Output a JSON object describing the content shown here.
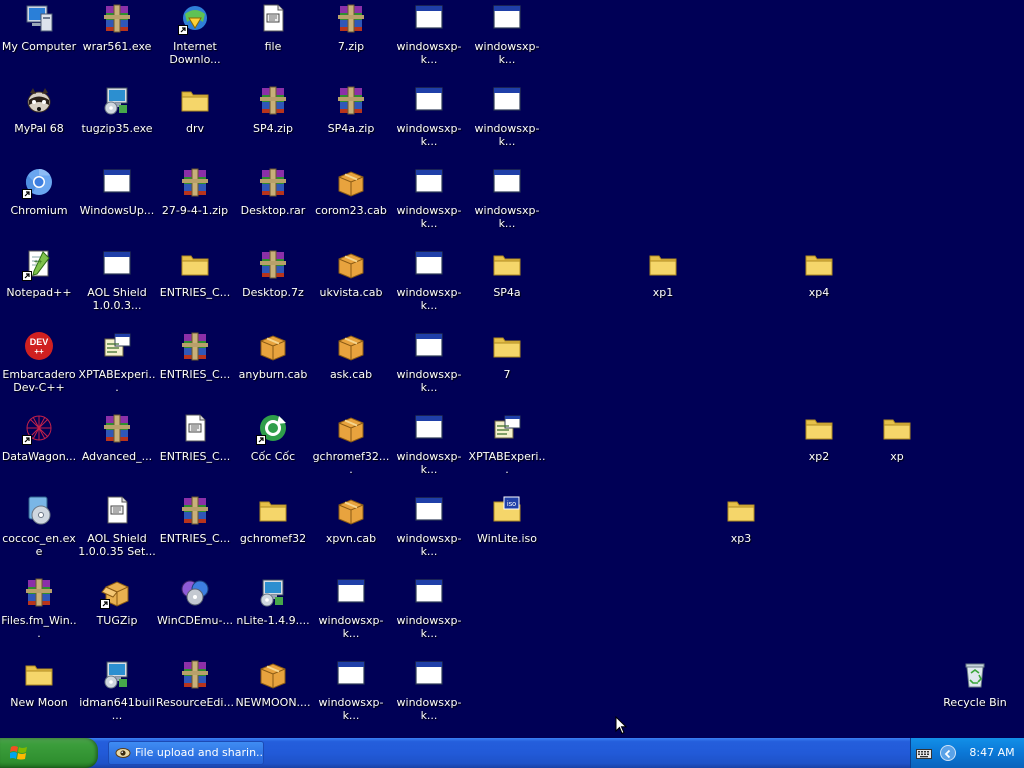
{
  "desktop": {
    "background": "#000056",
    "icons": [
      {
        "label": "My Computer",
        "type": "computer",
        "shortcut": false,
        "col": 0,
        "row": 0
      },
      {
        "label": "MyPal 68",
        "type": "raccoon",
        "shortcut": false,
        "col": 0,
        "row": 1
      },
      {
        "label": "Chromium",
        "type": "chromium",
        "shortcut": true,
        "col": 0,
        "row": 2
      },
      {
        "label": "Notepad++",
        "type": "notepadpp",
        "shortcut": true,
        "col": 0,
        "row": 3
      },
      {
        "label": "Embarcadero Dev-C++",
        "type": "devcpp",
        "shortcut": false,
        "col": 0,
        "row": 4
      },
      {
        "label": "DataWagon...",
        "type": "datawagon",
        "shortcut": true,
        "col": 0,
        "row": 5
      },
      {
        "label": "coccoc_en.exe",
        "type": "installer-cd",
        "shortcut": false,
        "col": 0,
        "row": 6
      },
      {
        "label": "Files.fm_Win...",
        "type": "rar",
        "shortcut": false,
        "col": 0,
        "row": 7
      },
      {
        "label": "New Moon",
        "type": "folder",
        "shortcut": false,
        "col": 0,
        "row": 8
      },
      {
        "label": "wrar561.exe",
        "type": "rar",
        "shortcut": false,
        "col": 1,
        "row": 0
      },
      {
        "label": "tugzip35.exe",
        "type": "installer-pc",
        "shortcut": false,
        "col": 1,
        "row": 1
      },
      {
        "label": "WindowsUp...",
        "type": "window",
        "shortcut": false,
        "col": 1,
        "row": 2
      },
      {
        "label": "AOL Shield 1.0.0.3...",
        "type": "window",
        "shortcut": false,
        "col": 1,
        "row": 3
      },
      {
        "label": "XPTABExperi...",
        "type": "setup",
        "shortcut": false,
        "col": 1,
        "row": 4
      },
      {
        "label": "Advanced_...",
        "type": "rar",
        "shortcut": false,
        "col": 1,
        "row": 5
      },
      {
        "label": "AOL Shield 1.0.0.35 Set...",
        "type": "ini",
        "shortcut": false,
        "col": 1,
        "row": 6
      },
      {
        "label": "TUGZip",
        "type": "box",
        "shortcut": true,
        "col": 1,
        "row": 7
      },
      {
        "label": "idman641buil...",
        "type": "installer-pc",
        "shortcut": false,
        "col": 1,
        "row": 8
      },
      {
        "label": "Internet Downlo...",
        "type": "idm",
        "shortcut": true,
        "col": 2,
        "row": 0
      },
      {
        "label": "drv",
        "type": "folder",
        "shortcut": false,
        "col": 2,
        "row": 1
      },
      {
        "label": "27-9-4-1.zip",
        "type": "rar",
        "shortcut": false,
        "col": 2,
        "row": 2
      },
      {
        "label": "ENTRIES_C...",
        "type": "folder",
        "shortcut": false,
        "col": 2,
        "row": 3
      },
      {
        "label": "ENTRIES_C...",
        "type": "rar",
        "shortcut": false,
        "col": 2,
        "row": 4
      },
      {
        "label": "ENTRIES_C...",
        "type": "ini",
        "shortcut": false,
        "col": 2,
        "row": 5
      },
      {
        "label": "ENTRIES_C...",
        "type": "rar",
        "shortcut": false,
        "col": 2,
        "row": 6
      },
      {
        "label": "WinCDEmu-...",
        "type": "cds",
        "shortcut": false,
        "col": 2,
        "row": 7
      },
      {
        "label": "ResourceEdi...",
        "type": "rar",
        "shortcut": false,
        "col": 2,
        "row": 8
      },
      {
        "label": "file",
        "type": "ini",
        "shortcut": false,
        "col": 3,
        "row": 0
      },
      {
        "label": "SP4.zip",
        "type": "rar",
        "shortcut": false,
        "col": 3,
        "row": 1
      },
      {
        "label": "Desktop.rar",
        "type": "rar",
        "shortcut": false,
        "col": 3,
        "row": 2
      },
      {
        "label": "Desktop.7z",
        "type": "rar",
        "shortcut": false,
        "col": 3,
        "row": 3
      },
      {
        "label": "anyburn.cab",
        "type": "cab",
        "shortcut": false,
        "col": 3,
        "row": 4
      },
      {
        "label": "Cốc Cốc",
        "type": "coccoc",
        "shortcut": true,
        "col": 3,
        "row": 5
      },
      {
        "label": "gchromef32",
        "type": "folder",
        "shortcut": false,
        "col": 3,
        "row": 6
      },
      {
        "label": "nLite-1.4.9....",
        "type": "installer-pc",
        "shortcut": false,
        "col": 3,
        "row": 7
      },
      {
        "label": "NEWMOON....",
        "type": "cab",
        "shortcut": false,
        "col": 3,
        "row": 8
      },
      {
        "label": "7.zip",
        "type": "rar",
        "shortcut": false,
        "col": 4,
        "row": 0
      },
      {
        "label": "SP4a.zip",
        "type": "rar",
        "shortcut": false,
        "col": 4,
        "row": 1
      },
      {
        "label": "corom23.cab",
        "type": "cab",
        "shortcut": false,
        "col": 4,
        "row": 2
      },
      {
        "label": "ukvista.cab",
        "type": "cab",
        "shortcut": false,
        "col": 4,
        "row": 3
      },
      {
        "label": "ask.cab",
        "type": "cab",
        "shortcut": false,
        "col": 4,
        "row": 4
      },
      {
        "label": "gchromef32....",
        "type": "cab",
        "shortcut": false,
        "col": 4,
        "row": 5
      },
      {
        "label": "xpvn.cab",
        "type": "cab",
        "shortcut": false,
        "col": 4,
        "row": 6
      },
      {
        "label": "windowsxp-k...",
        "type": "window",
        "shortcut": false,
        "col": 4,
        "row": 7
      },
      {
        "label": "windowsxp-k...",
        "type": "window",
        "shortcut": false,
        "col": 4,
        "row": 8
      },
      {
        "label": "windowsxp-k...",
        "type": "window",
        "shortcut": false,
        "col": 5,
        "row": 0
      },
      {
        "label": "windowsxp-k...",
        "type": "window",
        "shortcut": false,
        "col": 5,
        "row": 1
      },
      {
        "label": "windowsxp-k...",
        "type": "window",
        "shortcut": false,
        "col": 5,
        "row": 2
      },
      {
        "label": "windowsxp-k...",
        "type": "window",
        "shortcut": false,
        "col": 5,
        "row": 3
      },
      {
        "label": "windowsxp-k...",
        "type": "window",
        "shortcut": false,
        "col": 5,
        "row": 4
      },
      {
        "label": "windowsxp-k...",
        "type": "window",
        "shortcut": false,
        "col": 5,
        "row": 5
      },
      {
        "label": "windowsxp-k...",
        "type": "window",
        "shortcut": false,
        "col": 5,
        "row": 6
      },
      {
        "label": "windowsxp-k...",
        "type": "window",
        "shortcut": false,
        "col": 5,
        "row": 7
      },
      {
        "label": "windowsxp-k...",
        "type": "window",
        "shortcut": false,
        "col": 5,
        "row": 8
      },
      {
        "label": "windowsxp-k...",
        "type": "window",
        "shortcut": false,
        "col": 6,
        "row": 0
      },
      {
        "label": "windowsxp-k...",
        "type": "window",
        "shortcut": false,
        "col": 6,
        "row": 1
      },
      {
        "label": "windowsxp-k...",
        "type": "window",
        "shortcut": false,
        "col": 6,
        "row": 2
      },
      {
        "label": "SP4a",
        "type": "folder",
        "shortcut": false,
        "col": 6,
        "row": 3
      },
      {
        "label": "7",
        "type": "folder",
        "shortcut": false,
        "col": 6,
        "row": 4
      },
      {
        "label": "XPTABExperi...",
        "type": "setup",
        "shortcut": false,
        "col": 6,
        "row": 5
      },
      {
        "label": "WinLite.iso",
        "type": "iso",
        "shortcut": false,
        "col": 6,
        "row": 6
      },
      {
        "label": "xp1",
        "type": "folder",
        "shortcut": false,
        "col": 8,
        "row": 3
      },
      {
        "label": "xp3",
        "type": "folder",
        "shortcut": false,
        "col": 9,
        "row": 6
      },
      {
        "label": "xp4",
        "type": "folder",
        "shortcut": false,
        "col": 10,
        "row": 3
      },
      {
        "label": "xp2",
        "type": "folder",
        "shortcut": false,
        "col": 10,
        "row": 5
      },
      {
        "label": "xp",
        "type": "folder",
        "shortcut": false,
        "col": 11,
        "row": 5
      },
      {
        "label": "Recycle Bin",
        "type": "recycle",
        "shortcut": false,
        "col": 12,
        "row": 8
      }
    ]
  },
  "taskbar": {
    "start_label": "",
    "task_button": {
      "label": "File upload and sharin...",
      "icon": "eye-icon"
    },
    "tray": {
      "keyboard_icon": "keyboard-icon",
      "expand_icon": "tray-expand-icon",
      "clock": "8:47 AM"
    }
  }
}
